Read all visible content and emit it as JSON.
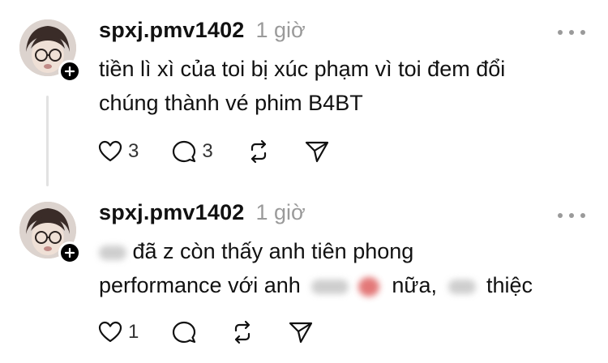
{
  "posts": [
    {
      "username": "spxj.pmv1402",
      "time": "1 giờ",
      "line1": "tiền lì xì của toi bị xúc phạm vì toi đem đổi",
      "line2": "chúng thành vé phim B4BT",
      "likes": "3",
      "replies": "3"
    },
    {
      "username": "spxj.pmv1402",
      "time": "1 giờ",
      "line1_after_blur": "đã z còn thấy anh tiên phong",
      "line2_part1": "performance với anh",
      "line2_part2": "nữa,",
      "line2_part3": "thiệc",
      "likes": "1"
    }
  ],
  "icons": {
    "more": "more-dots-icon",
    "like": "heart-icon",
    "reply": "comment-icon",
    "repost": "repost-icon",
    "share": "send-icon",
    "follow": "plus-icon"
  },
  "colors": {
    "text": "#111111",
    "muted": "#9a9a9a",
    "line": "#e2e2e2"
  }
}
